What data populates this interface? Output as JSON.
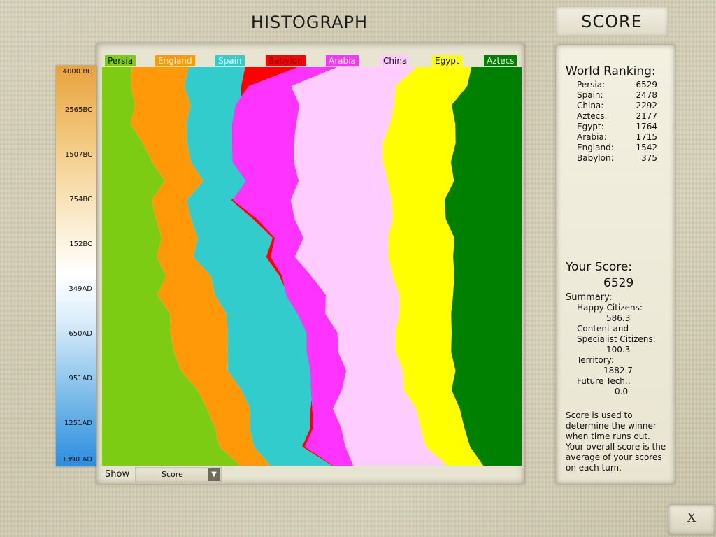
{
  "header": {
    "title": "HISTOGRAPH",
    "score_tab": "SCORE"
  },
  "legend": [
    {
      "name": "Persia",
      "color": "#7dcc14"
    },
    {
      "name": "England",
      "color": "#ff9908"
    },
    {
      "name": "Spain",
      "color": "#33cccc"
    },
    {
      "name": "Babylon",
      "color": "#ff0000"
    },
    {
      "name": "Arabia",
      "color": "#ff33ff"
    },
    {
      "name": "China",
      "color": "#ffccff"
    },
    {
      "name": "Egypt",
      "color": "#ffff00"
    },
    {
      "name": "Aztecs",
      "color": "#008000"
    }
  ],
  "time_ticks": [
    "4000 BC",
    "2565BC",
    "1507BC",
    "754BC",
    "152BC",
    "349AD",
    "650AD",
    "951AD",
    "1251AD",
    "1390 AD"
  ],
  "controls": {
    "show_label": "Show",
    "show_value": "Score",
    "close_label": "X"
  },
  "ranking": {
    "heading": "World Ranking:",
    "rows": [
      {
        "name": "Persia:",
        "value": "6529"
      },
      {
        "name": "Spain:",
        "value": "2478"
      },
      {
        "name": "China:",
        "value": "2292"
      },
      {
        "name": "Aztecs:",
        "value": "2177"
      },
      {
        "name": "Egypt:",
        "value": "1764"
      },
      {
        "name": "Arabia:",
        "value": "1715"
      },
      {
        "name": "England:",
        "value": "1542"
      },
      {
        "name": "Babylon:",
        "value": "375"
      }
    ]
  },
  "your_score": {
    "heading": "Your Score:",
    "value": "6529",
    "summary_label": "Summary:",
    "happy_label": "Happy Citizens:",
    "happy_value": "586.3",
    "content_label_1": "Content and",
    "content_label_2": "Specialist Citizens:",
    "content_value": "100.3",
    "territory_label": "Territory:",
    "territory_value": "1882.7",
    "future_label": "Future Tech.:",
    "future_value": "0.0",
    "note": [
      "Score is used to",
      "determine the winner",
      "when time runs out.",
      "Your overall score is the",
      "average of your scores",
      "on each turn."
    ]
  },
  "chart_data": {
    "type": "area",
    "orientation": "vertical-stacked-100%",
    "time_labels": [
      "4000 BC",
      "2565BC",
      "1507BC",
      "754BC",
      "152BC",
      "349AD",
      "650AD",
      "951AD",
      "1251AD",
      "1390 AD"
    ],
    "series_order": [
      "Persia",
      "England",
      "Spain",
      "Babylon",
      "Arabia",
      "China",
      "Egypt",
      "Aztecs"
    ],
    "boundaries_percent": [
      [
        7,
        21,
        34,
        47,
        56,
        75,
        88
      ],
      [
        7,
        20,
        33,
        35,
        45,
        70,
        87
      ],
      [
        8,
        21,
        33,
        32,
        47,
        70,
        83
      ],
      [
        7,
        20,
        33,
        31,
        46,
        69,
        84
      ],
      [
        10,
        20,
        33,
        31,
        46,
        67,
        84
      ],
      [
        12,
        21,
        35,
        31,
        46,
        67,
        83
      ],
      [
        15,
        24,
        38,
        34,
        47,
        68,
        84
      ],
      [
        12,
        20,
        31,
        31,
        45,
        69,
        82
      ],
      [
        13,
        21,
        36,
        37,
        46,
        69,
        82
      ],
      [
        14,
        23,
        41,
        41,
        48,
        68,
        84
      ],
      [
        13,
        22,
        39,
        40,
        46,
        68,
        84
      ],
      [
        15,
        26,
        42,
        43,
        50,
        69,
        84
      ],
      [
        13,
        27,
        44,
        44,
        53,
        71,
        84
      ],
      [
        16,
        30,
        47,
        47,
        53,
        71,
        83
      ],
      [
        16,
        30,
        49,
        49,
        56,
        70,
        83
      ],
      [
        17,
        30,
        49,
        49,
        56,
        70,
        83
      ],
      [
        19,
        30,
        50,
        50,
        58,
        72,
        84
      ],
      [
        23,
        33,
        50,
        50,
        57,
        72,
        83
      ],
      [
        25,
        35,
        50,
        50,
        55,
        75,
        85
      ],
      [
        27,
        35,
        50,
        50,
        57,
        76,
        86
      ],
      [
        28,
        36,
        48,
        48,
        58,
        77,
        88
      ],
      [
        33,
        40,
        55,
        55,
        60,
        82,
        91
      ]
    ]
  }
}
